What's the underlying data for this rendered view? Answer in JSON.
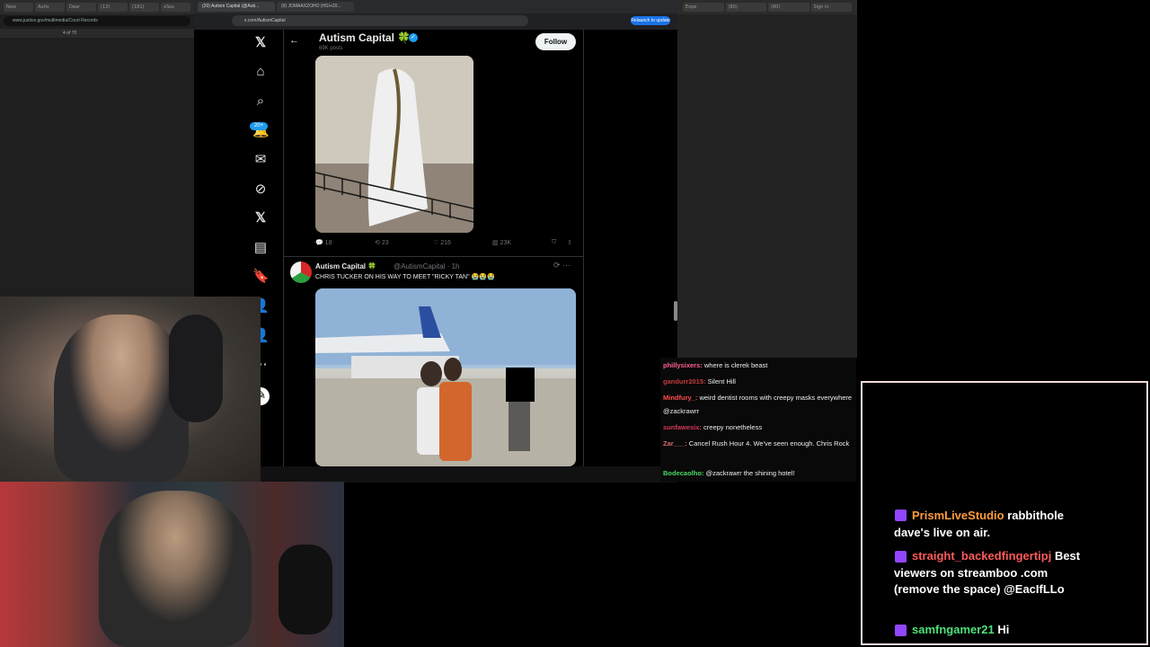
{
  "left_window": {
    "tabs": [
      "New",
      "Autis",
      "Dear",
      "(13)",
      "(181)",
      "xSex"
    ],
    "url": "www.justice.gov/multimedia/Court Records",
    "pdf_page": "4  of 70"
  },
  "center_browser": {
    "tabs": [
      "(20) Autism Capital (@Auti...",
      "(9) JOMAAXZOHO (HSI+20..."
    ],
    "url": "x.com/AutismCapital",
    "relaunch_label": "Relaunch to update"
  },
  "x": {
    "nav_badge": "20+",
    "profile": {
      "name": "Autism Capital 🍀",
      "posts_count": "69K posts",
      "follow_label": "Follow"
    },
    "post1": {
      "replies": "18",
      "reposts": "23",
      "likes": "216",
      "views": "23K"
    },
    "post2": {
      "name": "Autism Capital 🍀",
      "handle": "@AutismCapital · 1h",
      "text": "CHRIS TUCKER ON HIS WAY TO MEET \"RICKY TAN\" 😭😭😭"
    }
  },
  "right_window": {
    "tabs": [
      "Expe",
      "(80)",
      "(80)"
    ],
    "sign_in": "Sign in"
  },
  "overlay_chat": {
    "messages": [
      {
        "user": "phillysixers:",
        "user_color": "#ff5f8f",
        "text": "where is clerek beast"
      },
      {
        "user": "gandurr2015:",
        "user_color": "#c43b3b",
        "text": "Silent Hill"
      },
      {
        "user": "Mindfury_:",
        "user_color": "#ff4b4b",
        "text": "weird dentist rooms with creepy masks everywhere @zackrawrr"
      },
      {
        "user": "sunfawesix:",
        "user_color": "#d7385a",
        "text": "creepy nonetheless"
      },
      {
        "user": "Zar___:",
        "user_color": "#d46b6b",
        "text": "Cancel Rush Hour 4. We've seen enough. Chris Rock"
      },
      {
        "user": "Bodecaolho:",
        "user_color": "#4cd964",
        "text": "@zackrawrr the shining hotel!"
      }
    ]
  },
  "stream_chat": {
    "messages": [
      {
        "user": "PrismLiveStudio",
        "user_color": "#ff9b3d",
        "text": "rabbithole dave's live on air."
      },
      {
        "user": "straight_backedfingertipj",
        "user_color": "#ff5a5a",
        "text": "Best viewers on streamboo .com (remove the space) @EacIfLLo"
      },
      {
        "user": "samfngamer21",
        "user_color": "#4ee07a",
        "text": "Hi"
      }
    ]
  }
}
